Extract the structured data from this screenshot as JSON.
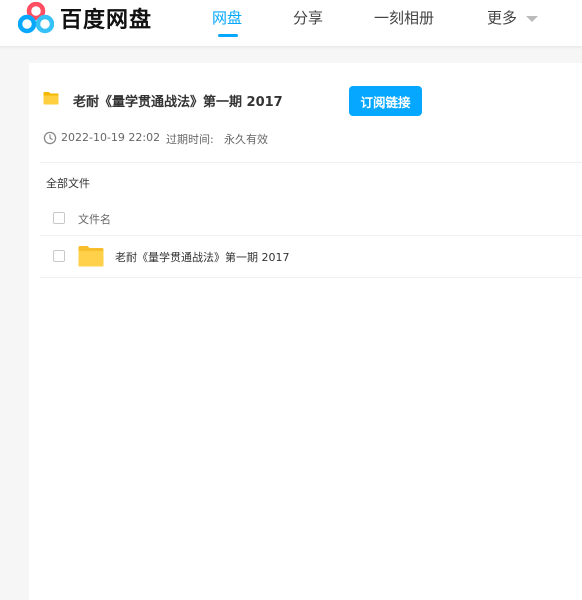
{
  "app": {
    "logo_text": "百度网盘"
  },
  "nav": {
    "items": [
      {
        "label": "网盘",
        "active": true
      },
      {
        "label": "分享",
        "active": false
      },
      {
        "label": "一刻相册",
        "active": false
      }
    ],
    "more_label": "更多"
  },
  "share": {
    "title": "老耐《量学贯通战法》第一期 2017",
    "subscribe_label": "订阅链接",
    "date": "2022-10-19 22:02",
    "expiry_label": "过期时间:",
    "expiry_value": "永久有效"
  },
  "breadcrumb": "全部文件",
  "file_list": {
    "column_name": "文件名",
    "rows": [
      {
        "name": "老耐《量学贯通战法》第一期 2017",
        "type": "folder"
      }
    ]
  },
  "colors": {
    "accent": "#06a7ff",
    "folder": "#ffd04a"
  },
  "icons": [
    "baidu-netdisk-logo-icon",
    "folder-icon",
    "clock-icon",
    "chevron-down-icon"
  ]
}
